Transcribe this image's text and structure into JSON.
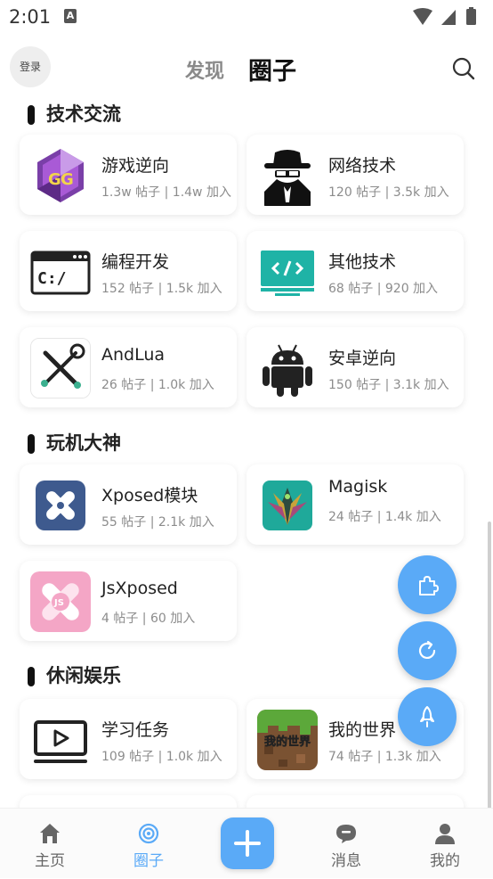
{
  "status_bar": {
    "time": "2:01",
    "notification_letter": "A"
  },
  "header": {
    "login": "登录",
    "tab_discover": "发现",
    "tab_circle": "圈子"
  },
  "sections": [
    {
      "title": "技术交流"
    },
    {
      "title": "玩机大神"
    },
    {
      "title": "休闲娱乐"
    }
  ],
  "cards": [
    {
      "name": "游戏逆向",
      "stat": "1.3w 帖子 | 1.4w 加入",
      "icon": "gameguardian-icon"
    },
    {
      "name": "网络技术",
      "stat": "120 帖子 | 3.5k 加入",
      "icon": "hacker-icon"
    },
    {
      "name": "编程开发",
      "stat": "152 帖子 | 1.5k 加入",
      "icon": "terminal-icon"
    },
    {
      "name": "其他技术",
      "stat": "68 帖子 | 920 加入",
      "icon": "code-monitor-icon"
    },
    {
      "name": "AndLua",
      "stat": "26 帖子 | 1.0k 加入",
      "icon": "tools-icon"
    },
    {
      "name": "安卓逆向",
      "stat": "150 帖子 | 3.1k 加入",
      "icon": "android-icon"
    },
    {
      "name": "Xposed模块",
      "stat": "55 帖子 | 2.1k 加入",
      "icon": "xposed-icon"
    },
    {
      "name": "Magisk",
      "stat": "24 帖子 | 1.4k 加入",
      "icon": "magisk-icon"
    },
    {
      "name": "JsXposed",
      "stat": "4 帖子 | 60 加入",
      "icon": "jsxposed-icon"
    },
    {
      "name": "学习任务",
      "stat": "109 帖子 | 1.0k 加入",
      "icon": "video-icon"
    },
    {
      "name": "我的世界",
      "stat": "74 帖子 | 1.3k 加入",
      "icon": "minecraft-icon"
    }
  ],
  "minecraft_logo_text": "我的世界",
  "fab": {
    "buttons": [
      "puzzle-icon",
      "refresh-icon",
      "rocket-icon"
    ]
  },
  "bottom_nav": {
    "home": "主页",
    "circle": "圈子",
    "messages": "消息",
    "mine": "我的"
  },
  "colors": {
    "accent": "#5aaaf7",
    "text_primary": "#222222",
    "text_secondary": "#8c8c8c"
  }
}
